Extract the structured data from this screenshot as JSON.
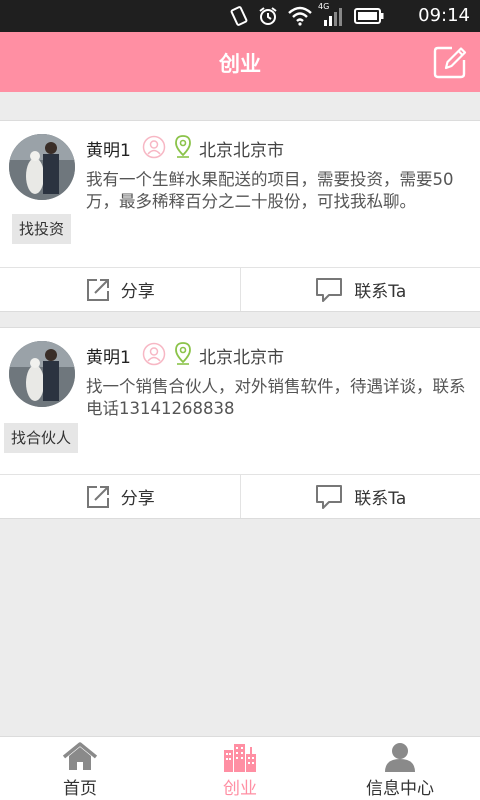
{
  "status_bar": {
    "time": "09:14",
    "network": "4G",
    "icons": [
      "vibrate-icon",
      "alarm-icon",
      "wifi-icon",
      "signal-icon",
      "battery-icon"
    ]
  },
  "header": {
    "title": "创业",
    "edit_icon": "edit-icon"
  },
  "posts": [
    {
      "name": "黄明1",
      "location": "北京北京市",
      "description": "我有一个生鲜水果配送的项目，需要投资，需要50万，最多稀释百分之二十股份，可找我私聊。",
      "tag": "找投资",
      "share_label": "分享",
      "contact_label": "联系Ta"
    },
    {
      "name": "黄明1",
      "location": "北京北京市",
      "description": "找一个销售合伙人，对外销售软件，待遇详谈，联系电话13141268838",
      "tag": "找合伙人",
      "share_label": "分享",
      "contact_label": "联系Ta"
    }
  ],
  "bottom_nav": {
    "items": [
      {
        "label": "首页",
        "icon": "home-icon",
        "active": false
      },
      {
        "label": "创业",
        "icon": "buildings-icon",
        "active": true
      },
      {
        "label": "信息中心",
        "icon": "person-icon",
        "active": false
      }
    ]
  },
  "colors": {
    "accent": "#ff8fa3",
    "location_green": "#8bc34a"
  }
}
